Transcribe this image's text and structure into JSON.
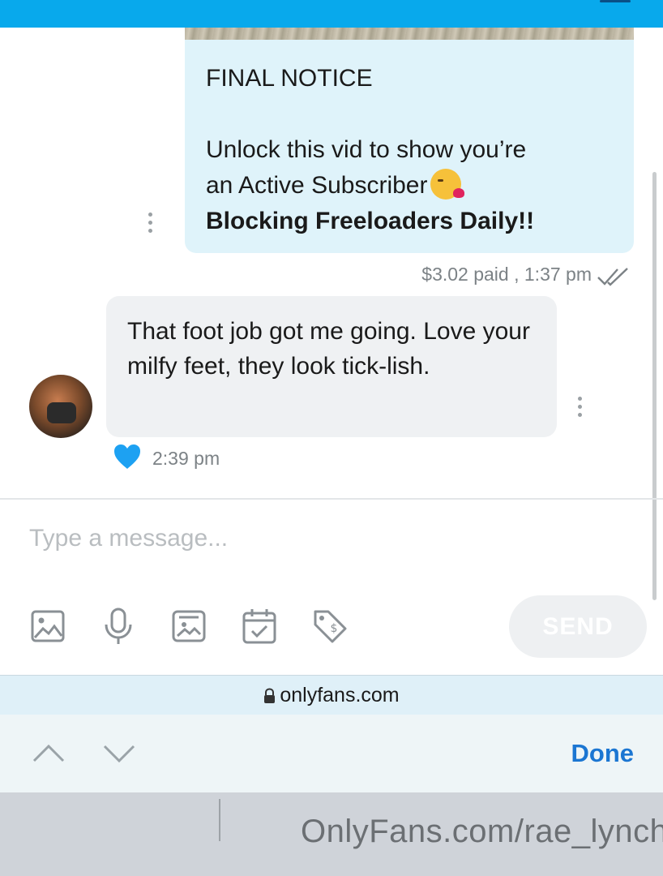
{
  "browser": {
    "url": "onlyfans.com",
    "done_label": "Done"
  },
  "messages": {
    "sent": {
      "title": "FINAL NOTICE",
      "line1": "Unlock this vid to show you’re",
      "line2": "an Active Subscriber",
      "line3": "Blocking Freeloaders Daily!!",
      "emoji": "kissing-face-with-heart-emoji",
      "meta": "$3.02 paid , 1:37 pm"
    },
    "received": {
      "text": "That foot job got me going. Love your milfy feet, they look tick-lish.",
      "time": "2:39 pm"
    }
  },
  "composer": {
    "placeholder": "Type a message...",
    "send_label": "SEND"
  },
  "watermark": "OnlyFans.com/rae_lynch",
  "colors": {
    "topbar": "#08a9ec",
    "sent_bubble": "#dff3fa",
    "received_bubble": "#eff1f3",
    "like": "#1da1f2",
    "done": "#1b76d2"
  }
}
